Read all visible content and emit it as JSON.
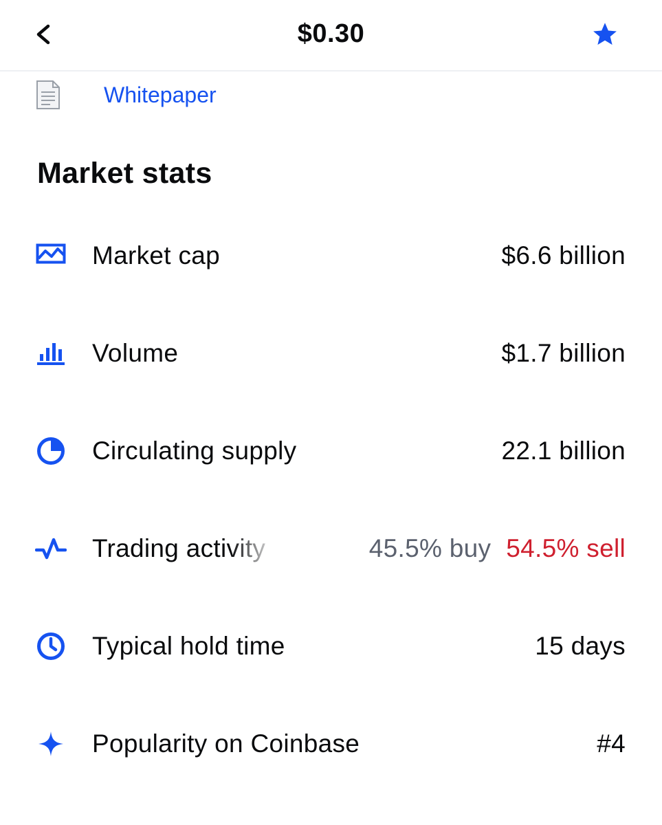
{
  "header": {
    "title": "$0.30",
    "back_icon": "chevron-left-icon",
    "star_icon": "star-icon"
  },
  "links": {
    "whitepaper_label": "Whitepaper",
    "whitepaper_icon": "document-icon"
  },
  "market_stats": {
    "title": "Market stats",
    "rows": [
      {
        "label": "Market cap",
        "value": "$6.6 billion",
        "icon": "area-chart-icon"
      },
      {
        "label": "Volume",
        "value": "$1.7 billion",
        "icon": "bar-chart-icon"
      },
      {
        "label": "Circulating supply",
        "value": "22.1 billion",
        "icon": "pie-chart-icon"
      },
      {
        "label": "Trading activity",
        "buy": "45.5% buy",
        "sell": "54.5% sell",
        "icon": "activity-icon"
      },
      {
        "label": "Typical hold time",
        "value": "15 days",
        "icon": "clock-icon"
      },
      {
        "label": "Popularity on Coinbase",
        "value": "#4",
        "icon": "sparkle-icon"
      }
    ]
  },
  "colors": {
    "accent": "#1652f0",
    "sell": "#cf202f",
    "buy": "#5b616e",
    "text": "#0a0b0d",
    "doc_icon": "#9aa0a8"
  }
}
